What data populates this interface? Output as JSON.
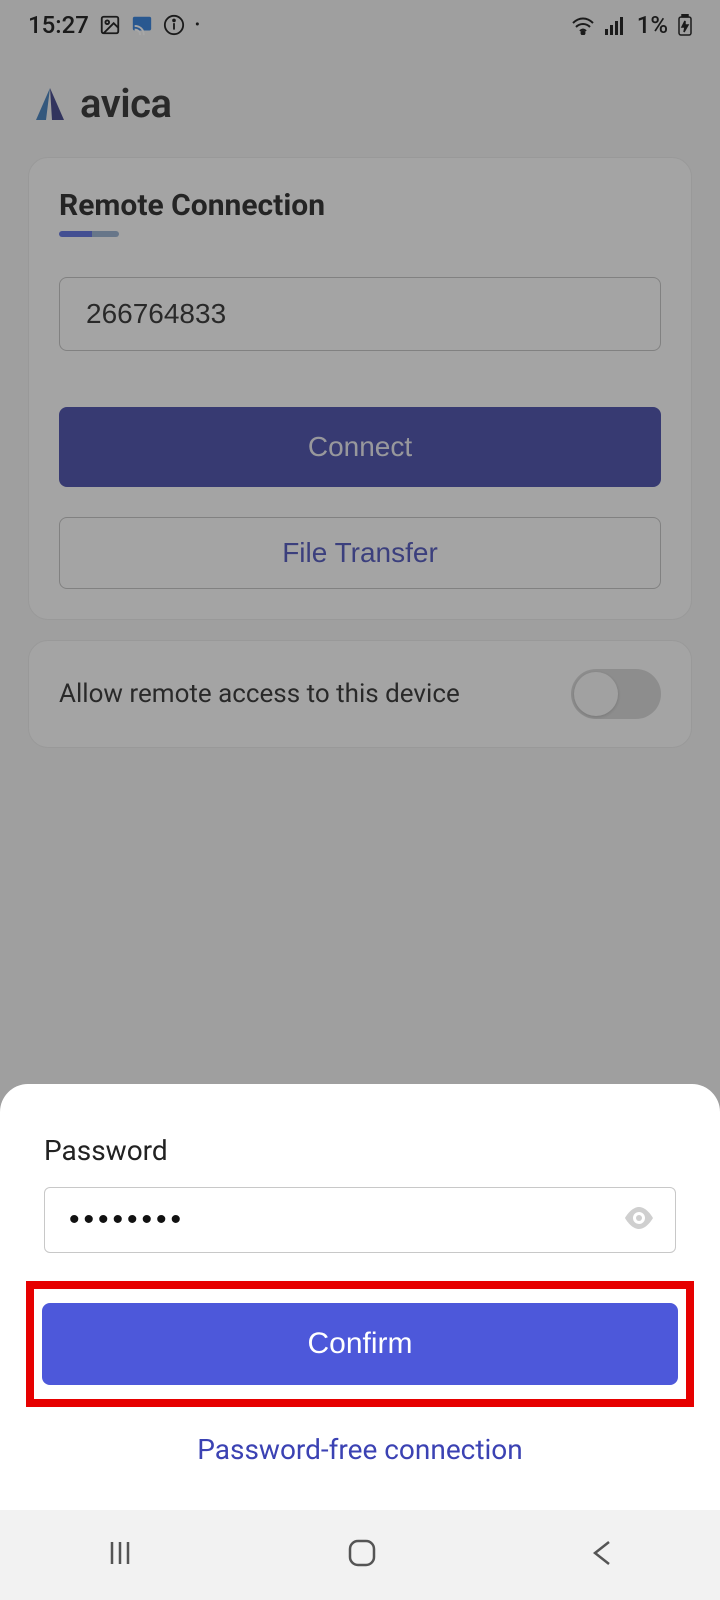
{
  "status": {
    "time": "15:27",
    "battery": "1%"
  },
  "app": {
    "name": "avica"
  },
  "remote": {
    "title": "Remote Connection",
    "id_value": "266764833",
    "connect_label": "Connect",
    "file_transfer_label": "File Transfer"
  },
  "access_toggle": {
    "label": "Allow remote access to this device",
    "enabled": false
  },
  "sheet": {
    "label": "Password",
    "password_masked": "••••••••",
    "confirm_label": "Confirm",
    "pwfree_label": "Password-free connection"
  }
}
